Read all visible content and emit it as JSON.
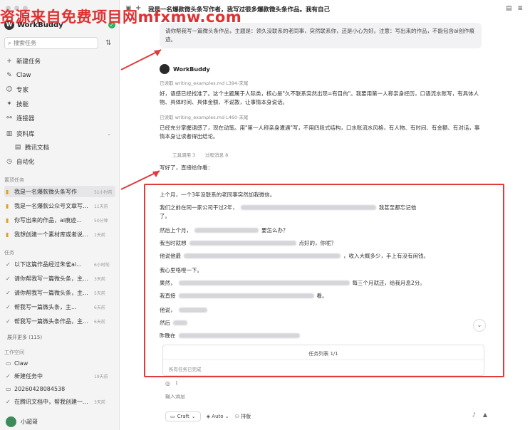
{
  "watermark": "资源来自免费项目网mfxmw.com",
  "app": {
    "name": "WorkBuddy"
  },
  "search": {
    "placeholder": "搜索任务"
  },
  "nav": {
    "new_task": "新建任务",
    "claw": "Claw",
    "expert": "专家",
    "skills": "技能",
    "connectors": "连接器",
    "library": "资料库",
    "tencent_docs": "腾讯文档",
    "automation": "自动化"
  },
  "sections": {
    "recent": "置顶任务",
    "tasks": "任务",
    "workspace": "工作空间"
  },
  "pinned_tasks": [
    {
      "title": "我是一名爆款微头条写作",
      "time": "51小时前"
    },
    {
      "title": "我是一名爆款公众号文章写...",
      "time": "11天前"
    },
    {
      "title": "你写出来的作品，ai痕迹...",
      "time": "50分钟"
    },
    {
      "title": "我想创建一个素材库或者说...",
      "time": "1天前"
    }
  ],
  "tasks": [
    {
      "title": "以下这篇作品经过朱雀ai...",
      "time": "6小时前"
    },
    {
      "title": "请你帮我写一篇微头条，主...",
      "time": "3天前"
    },
    {
      "title": "请你帮我写一篇微头条，主...",
      "time": "5天前"
    },
    {
      "title": "帮我写一篇微头条，主...",
      "time": "6天前"
    },
    {
      "title": "帮我写一篇微头条作品，主...",
      "time": "6天前"
    }
  ],
  "show_more": "展开更多 (115)",
  "workspace": [
    {
      "title": "Claw",
      "time": ""
    },
    {
      "title": "新建任务中",
      "time": "19天前"
    },
    {
      "title": "20260428084538",
      "time": ""
    },
    {
      "title": "在腾讯文档中，帮我创建一...",
      "time": "3天前"
    }
  ],
  "user": {
    "name": "小超哥"
  },
  "topbar": {
    "title": "我是一名爆款微头条写作者，我写过很多爆款微头条作品。我有自己"
  },
  "prompt": {
    "text": "请你帮我写一篇微头条作品，主题是：领久没联系的老同事，突然联系你，还是小心为好。注意：写出来的作品，不能包含ai创作痕迹。"
  },
  "bot": {
    "name": "WorkBuddy",
    "read1": "已读取  writing_examples.md  L394-末尾",
    "para1": "好，语感已经找准了。这个主题属于人际类，核心是\"久不联系突然出现=有目的\"。我要用第一人称亲身经历，口语流水账写，有具体人物、具体时间、具体金额、不说教，让事情本身说话。",
    "read2": "已读取  writing_examples.md  L460-末尾",
    "para2": "已经充分掌握语感了，现在动笔。用\"第一人称亲身遭遇\"写，不用四段式结构，口水账流水风格，有人物、有时间、有金额、有对话，事情本身让读者得出结论。",
    "chip1": "工具调用 3",
    "chip2": "过程消息 8",
    "done": "写好了，直接给你看："
  },
  "article": {
    "lines": [
      "上个月，一个3年没联系的老同事突然加我微信。",
      "我们之前在同一家公司干过2年，",
      "了。",
      "然后上个月，",
      "我当时就想",
      "他说他最",
      "我心里咯噔一下。",
      "果然，",
      "我直接",
      "他说，",
      "然后",
      "昨晚在"
    ],
    "line2_tail": "我甚至都忘记他",
    "line4_tail": "要怎么办？",
    "line5_tail": "点好的，你呢？",
    "line6_tail": "，收入大概多少，手上有没有闲钱。",
    "line8_tail": "每三个月就还，给我月息2分。",
    "line9_tail": "看。",
    "task_panel_title": "任务列表 1/1",
    "task_panel_status": "所有任务已完成"
  },
  "composer": {
    "placeholder": "输入消息",
    "mode": "Craft",
    "model": "Auto",
    "plan": "排版"
  }
}
